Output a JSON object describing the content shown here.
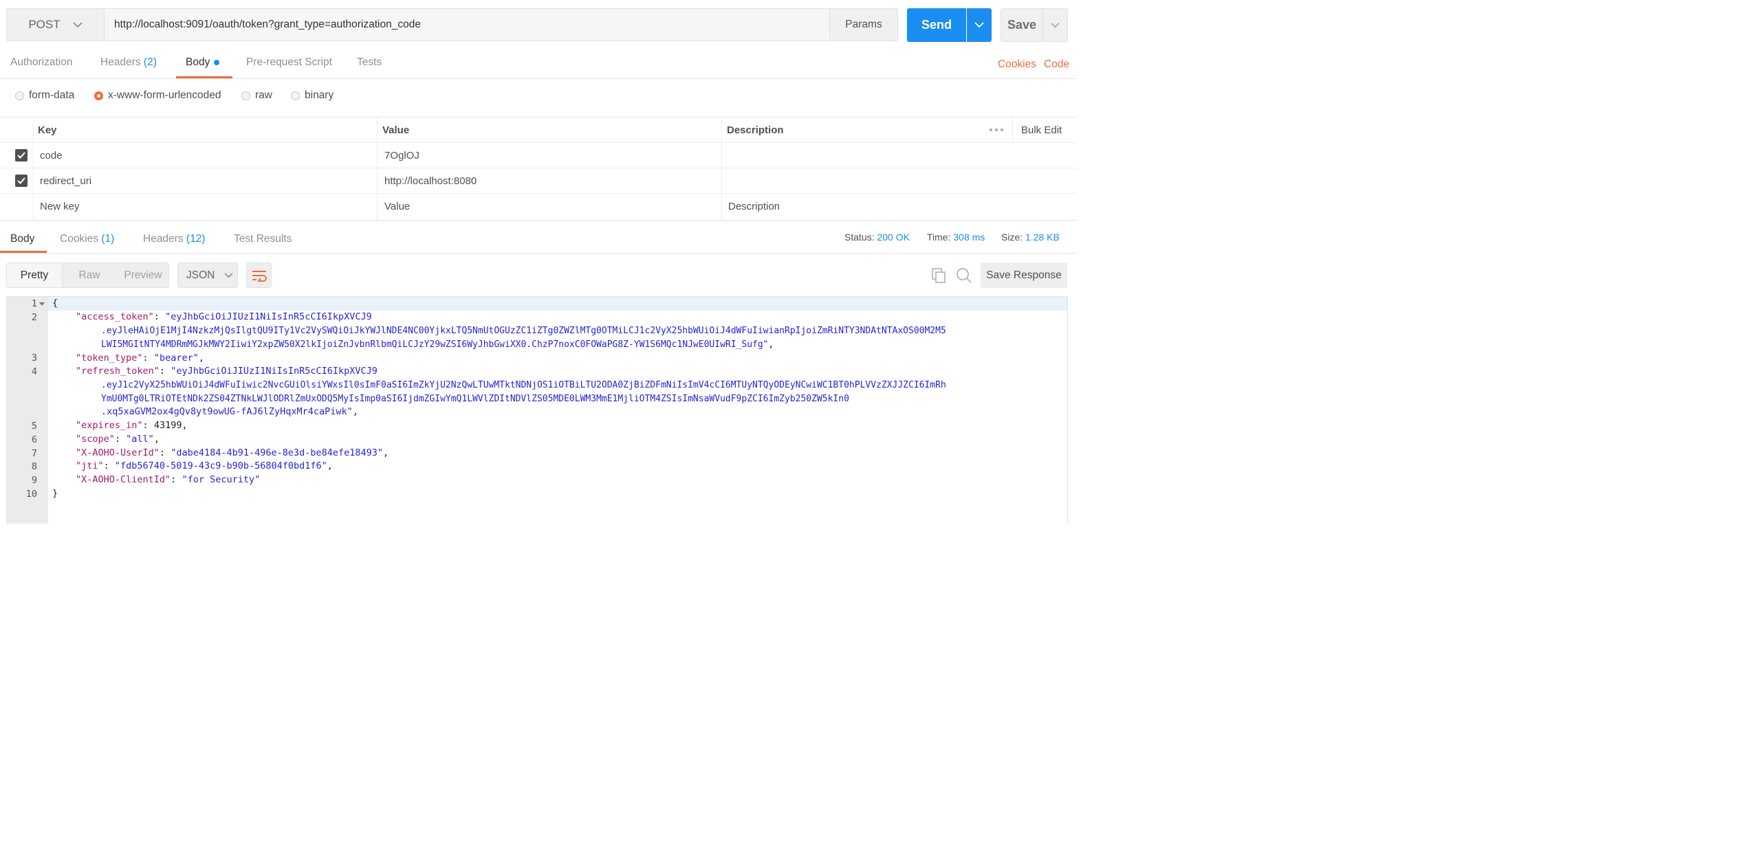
{
  "request": {
    "method": "POST",
    "url": "http://localhost:9091/oauth/token?grant_type=authorization_code",
    "params_label": "Params",
    "send_label": "Send",
    "save_label": "Save"
  },
  "request_tabs": {
    "authorization": "Authorization",
    "headers": "Headers",
    "headers_count": "(2)",
    "body": "Body",
    "prerequest": "Pre-request Script",
    "tests": "Tests",
    "cookies": "Cookies",
    "code": "Code"
  },
  "body_modes": {
    "form_data": "form-data",
    "urlencoded": "x-www-form-urlencoded",
    "raw": "raw",
    "binary": "binary",
    "selected": "x-www-form-urlencoded"
  },
  "kv_table": {
    "headers": {
      "key": "Key",
      "value": "Value",
      "description": "Description",
      "bulk_edit": "Bulk Edit"
    },
    "rows": [
      {
        "key": "code",
        "value": "7OglOJ",
        "description": "",
        "checked": true
      },
      {
        "key": "redirect_uri",
        "value": "http://localhost:8080",
        "description": "",
        "checked": true
      }
    ],
    "placeholders": {
      "key": "New key",
      "value": "Value",
      "description": "Description"
    }
  },
  "response_tabs": {
    "body": "Body",
    "cookies": "Cookies",
    "cookies_count": "(1)",
    "headers": "Headers",
    "headers_count": "(12)",
    "test_results": "Test Results"
  },
  "response_meta": {
    "status_label": "Status:",
    "status_value": "200 OK",
    "time_label": "Time:",
    "time_value": "308 ms",
    "size_label": "Size:",
    "size_value": "1.28 KB"
  },
  "response_toolbar": {
    "pretty": "Pretty",
    "raw": "Raw",
    "preview": "Preview",
    "format": "JSON",
    "save_response": "Save Response"
  },
  "code": {
    "line_numbers": [
      "1",
      "2",
      "3",
      "4",
      "5",
      "6",
      "7",
      "8",
      "9",
      "10"
    ],
    "open_brace": "{",
    "close_brace": "}",
    "access_token_key": "\"access_token\"",
    "access_token_1": "\"eyJhbGciOiJIUzI1NiIsInR5cCI6IkpXVCJ9",
    "access_token_2": ".eyJleHAiOjE1MjI4NzkzMjQsIlgtQU9ITy1Vc2VySWQiOiJkYWJlNDE4NC00YjkxLTQ5NmUtOGUzZC1iZTg0ZWZlMTg0OTMiLCJ1c2VyX25hbWUiOiJ4dWFuIiwianRpIjoiZmRiNTY3NDAtNTAxOS00M2M5",
    "access_token_3": "LWI5MGItNTY4MDRmMGJkMWY2IiwiY2xpZW50X2lkIjoiZnJvbnRlbmQiLCJzY29wZSI6WyJhbGwiXX0.ChzP7noxC0FOWaPG8Z-YW1S6MQc1NJwE0UIwRI_Sufg\"",
    "token_type_key": "\"token_type\"",
    "token_type_val": "\"bearer\"",
    "refresh_token_key": "\"refresh_token\"",
    "refresh_token_1": "\"eyJhbGciOiJIUzI1NiIsInR5cCI6IkpXVCJ9",
    "refresh_token_2": ".eyJ1c2VyX25hbWUiOiJ4dWFuIiwic2NvcGUiOlsiYWxsIl0sImF0aSI6ImZkYjU2NzQwLTUwMTktNDNjOS1iOTBiLTU2ODA0ZjBiZDFmNiIsImV4cCI6MTUyNTQyODEyNCwiWC1BT0hPLVVzZXJJZCI6ImRh",
    "refresh_token_3": "YmU0MTg0LTRiOTEtNDk2ZS04ZTNkLWJlODRlZmUxODQ5MyIsImp0aSI6IjdmZGIwYmQ1LWVlZDItNDVlZS05MDE0LWM3MmE1MjliOTM4ZSIsImNsaWVudF9pZCI6ImZyb250ZW5kIn0",
    "refresh_token_4": ".xq5xaGVM2ox4gQv8yt9owUG-fAJ6lZyHqxMr4caPiwk\"",
    "expires_in_key": "\"expires_in\"",
    "expires_in_val": "43199",
    "scope_key": "\"scope\"",
    "scope_val": "\"all\"",
    "userid_key": "\"X-AOHO-UserId\"",
    "userid_val": "\"dabe4184-4b91-496e-8e3d-be84efe18493\"",
    "jti_key": "\"jti\"",
    "jti_val": "\"fdb56740-5019-43c9-b90b-56804f0bd1f6\"",
    "clientid_key": "\"X-AOHO-ClientId\"",
    "clientid_val": "\"for Security\""
  },
  "colors": {
    "accent_blue": "#1a8ef0",
    "accent_orange": "#f26b3a",
    "json_key": "#a11c6a",
    "json_string": "#2525d6"
  }
}
